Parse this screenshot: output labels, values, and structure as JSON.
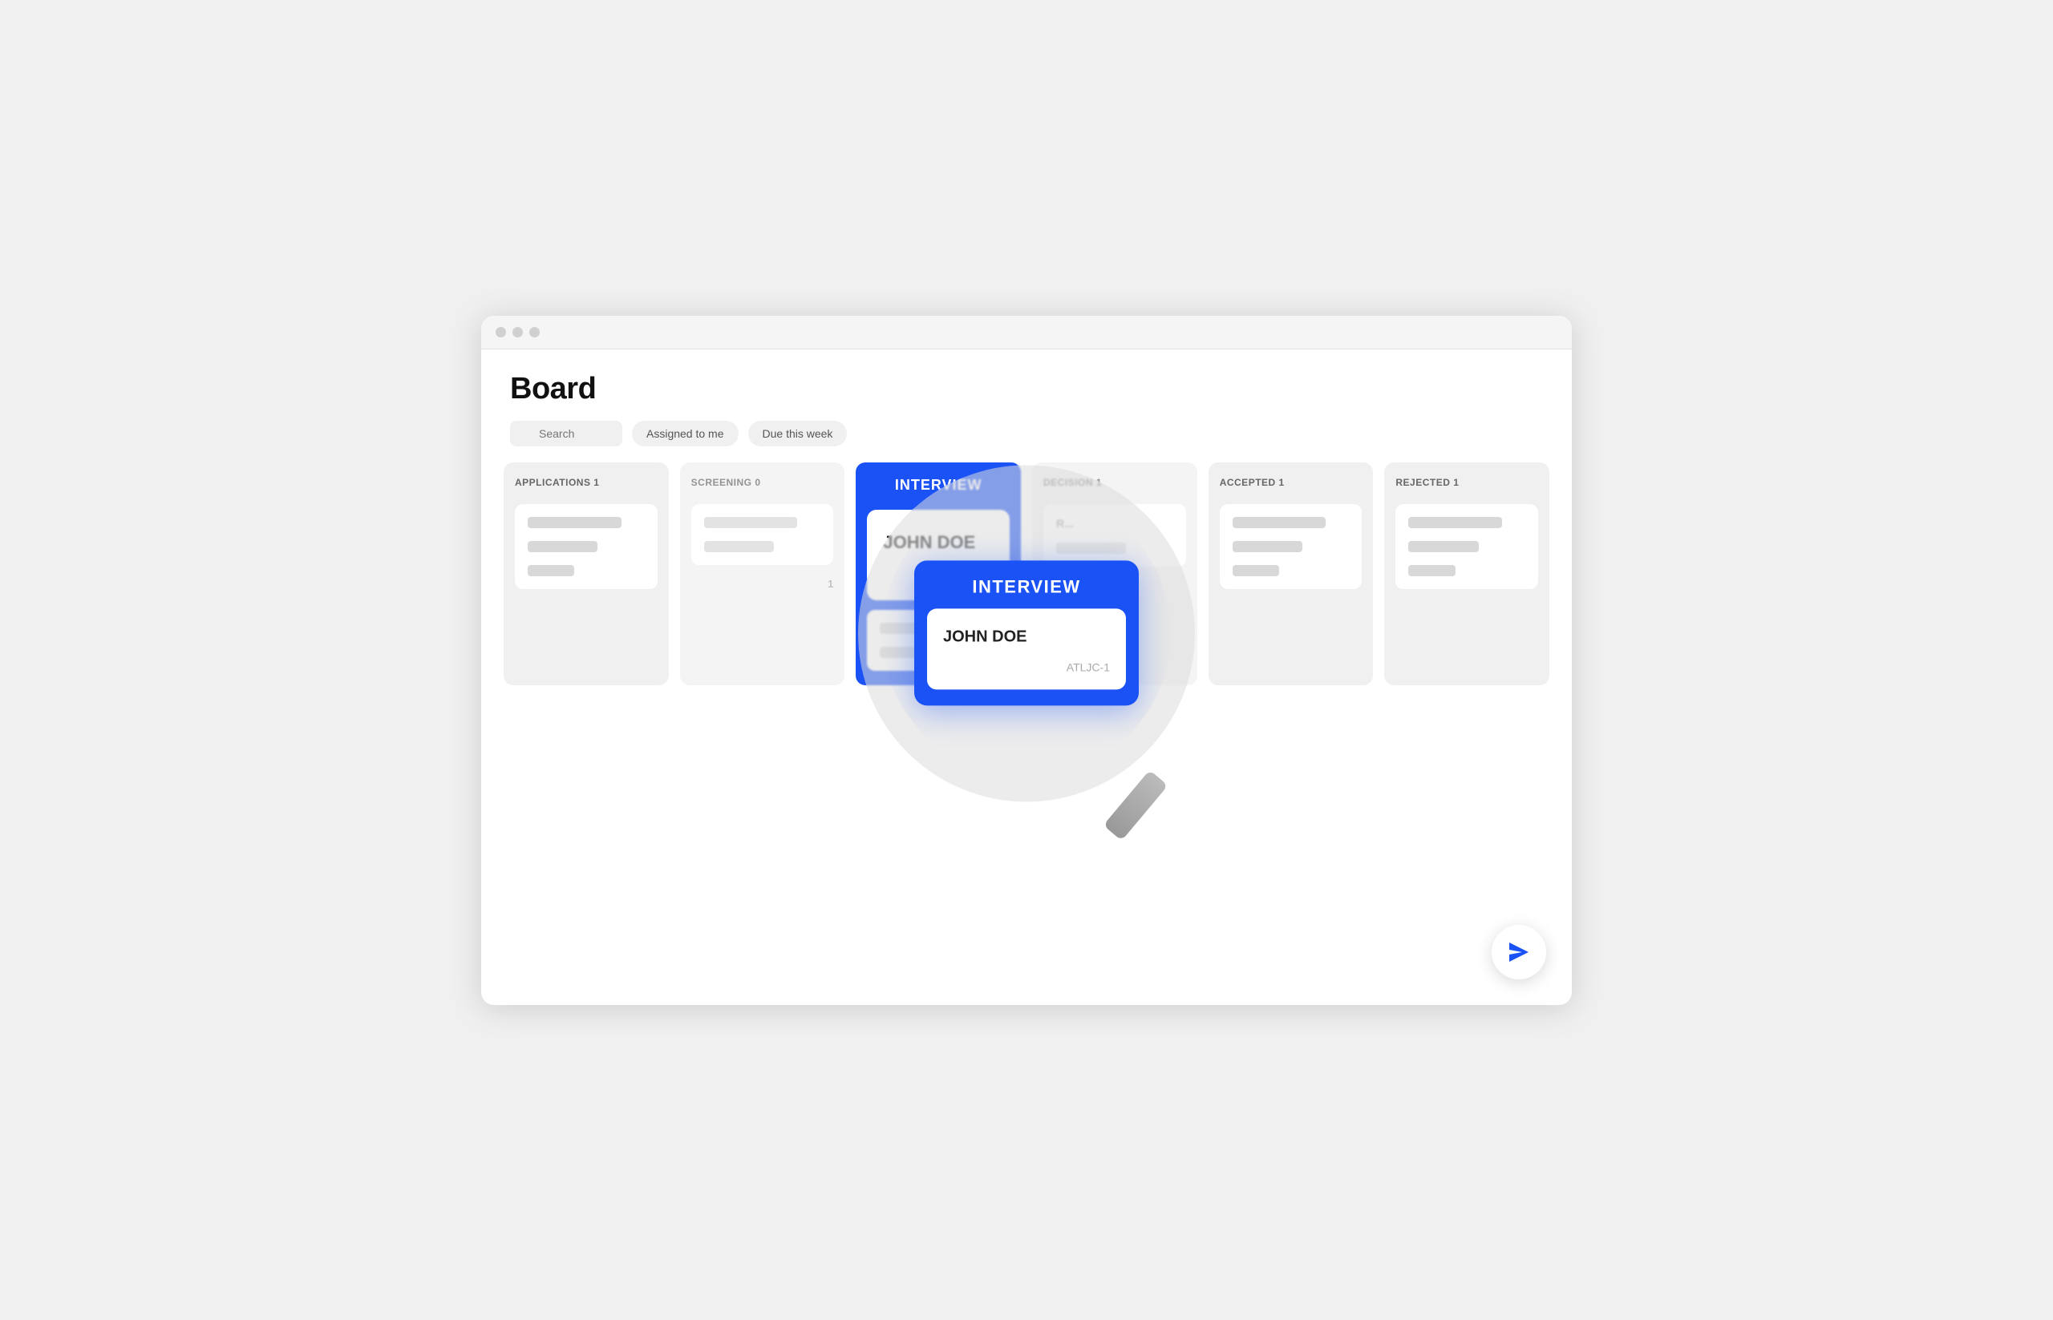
{
  "window": {
    "title": "Board"
  },
  "header": {
    "title": "Board"
  },
  "toolbar": {
    "search_placeholder": "Search",
    "filter1_label": "Assigned to me",
    "filter2_label": "Due this week"
  },
  "columns": [
    {
      "id": "applications",
      "header": "APPLICATIONS 1",
      "cards": [
        {
          "bar1": "",
          "bar2": ""
        }
      ]
    },
    {
      "id": "screening",
      "header": "SCREENING 0",
      "cards": [
        {
          "bar1": "",
          "bar2": ""
        }
      ]
    },
    {
      "id": "interview",
      "header": "INTERVIEW",
      "cards": [
        {
          "name": "JOHN DOE",
          "ticket": "ATLJC-1"
        },
        {
          "bar1": "",
          "bar2": ""
        }
      ],
      "highlighted": true
    },
    {
      "id": "decision",
      "header": "DECISION 1",
      "cards": [
        {
          "bar1": "",
          "bar2": ""
        }
      ]
    },
    {
      "id": "accepted",
      "header": "ACCEPTED 1",
      "cards": [
        {
          "bar1": "",
          "bar2": ""
        }
      ]
    },
    {
      "id": "rejected",
      "header": "REJECTED 1",
      "cards": [
        {
          "bar1": "",
          "bar2": ""
        }
      ]
    }
  ],
  "magnifier": {
    "column_header": "INTERVIEW",
    "card_name": "JOHN DOE",
    "card_ticket": "ATLJC-1"
  },
  "fab": {
    "label": "Send",
    "icon": "send-icon"
  },
  "colors": {
    "accent": "#1a52f5",
    "card_bg": "#ffffff",
    "column_bg": "#f0f0f0",
    "bar_color": "#d8d8d8"
  }
}
